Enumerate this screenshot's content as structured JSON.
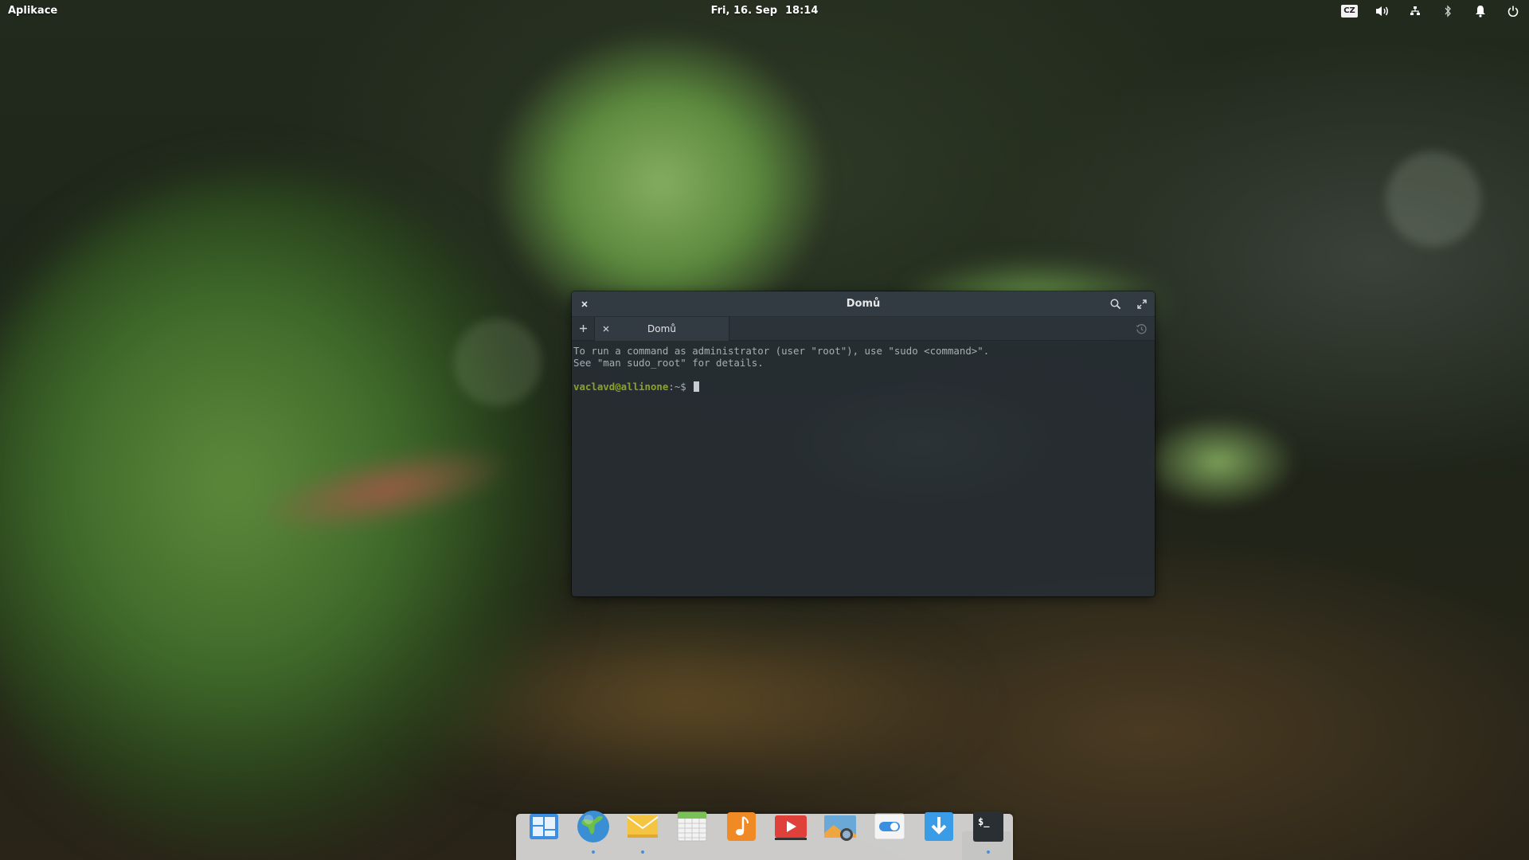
{
  "panel": {
    "apps_label": "Aplikace",
    "date": "Fri, 16. Sep",
    "time": "18:14",
    "keyboard_layout": "CZ",
    "indicators": [
      "keyboard-layout-icon",
      "volume-icon",
      "network-icon",
      "bluetooth-icon",
      "notifications-icon",
      "power-icon"
    ]
  },
  "terminal": {
    "window_title": "Domů",
    "tab_label": "Domů",
    "output_lines": [
      "To run a command as administrator (user \"root\"), use \"sudo <command>\".",
      "See \"man sudo_root\" for details."
    ],
    "prompt_user": "vaclavd@allinone",
    "prompt_path": ":~$ "
  },
  "dock": {
    "apps": [
      {
        "name": "multitasking-view-icon",
        "running": false
      },
      {
        "name": "web-browser-icon",
        "running": true
      },
      {
        "name": "mail-icon",
        "running": true
      },
      {
        "name": "calendar-icon",
        "running": false
      },
      {
        "name": "music-icon",
        "running": false
      },
      {
        "name": "videos-icon",
        "running": false
      },
      {
        "name": "photos-icon",
        "running": false
      },
      {
        "name": "system-settings-icon",
        "running": false
      },
      {
        "name": "appcenter-icon",
        "running": false
      },
      {
        "name": "terminal-icon",
        "running": true
      }
    ],
    "terminal_icon_text": "$_"
  },
  "colors": {
    "prompt_user": "#8ba12c",
    "terminal_text": "#a7aeb3",
    "running_dot": "#4a90d9"
  }
}
